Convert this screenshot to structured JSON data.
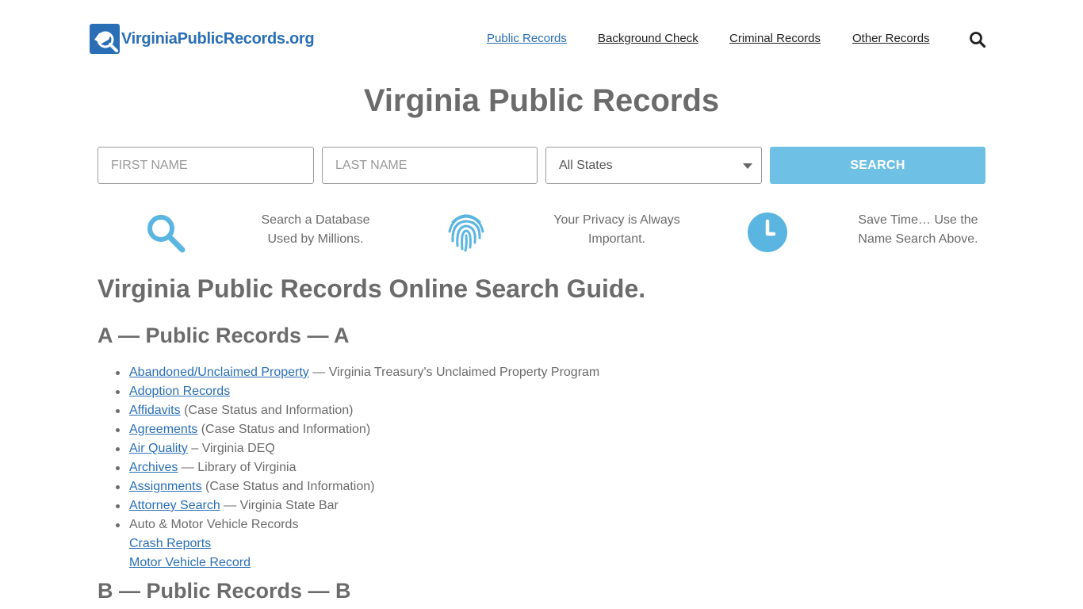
{
  "header": {
    "logo_text": "VirginiaPublicRecords.org",
    "nav": [
      {
        "label": "Public Records",
        "active": true
      },
      {
        "label": "Background Check",
        "active": false
      },
      {
        "label": "Criminal Records",
        "active": false
      },
      {
        "label": "Other Records",
        "active": false
      }
    ],
    "search_icon": "search-icon"
  },
  "title": "Virginia Public Records",
  "search": {
    "first_name_placeholder": "FIRST NAME",
    "last_name_placeholder": "LAST NAME",
    "state_selected": "All States",
    "button_label": "SEARCH"
  },
  "features": [
    {
      "icon": "search-icon",
      "line1": "Search a Database",
      "line2": "Used by Millions."
    },
    {
      "icon": "fingerprint-icon",
      "line1": "Your Privacy is Always",
      "line2": "Important."
    },
    {
      "icon": "clock-icon",
      "line1": "Save Time… Use the",
      "line2": "Name Search Above."
    }
  ],
  "guide_title": "Virginia Public Records Online Search Guide.",
  "section_a": "A — Public Records — A",
  "section_b": "B — Public Records — B",
  "records": [
    {
      "link": "Abandoned/Unclaimed Property",
      "text": " — Virginia Treasury's Unclaimed Property Program"
    },
    {
      "link": "Adoption Records",
      "text": ""
    },
    {
      "link": "Affidavits",
      "text": " (Case Status and Information)"
    },
    {
      "link": "Agreements",
      "text": " (Case Status and Information)"
    },
    {
      "link": "Air Quality",
      "text": " – Virginia DEQ"
    },
    {
      "link": "Archives",
      "text": " — Library of Virginia"
    },
    {
      "link": "Assignments",
      "text": " (Case Status and Information)"
    },
    {
      "link": "Attorney Search",
      "text": " — Virginia State Bar"
    },
    {
      "link": "",
      "text": "Auto & Motor Vehicle Records"
    }
  ],
  "sub_records": [
    "Crash Reports",
    "Motor Vehicle Record"
  ],
  "colors": {
    "accent": "#2a6fb6",
    "button": "#6ec1e4",
    "icon": "#5ab5e0",
    "text": "#6b6b6b"
  }
}
